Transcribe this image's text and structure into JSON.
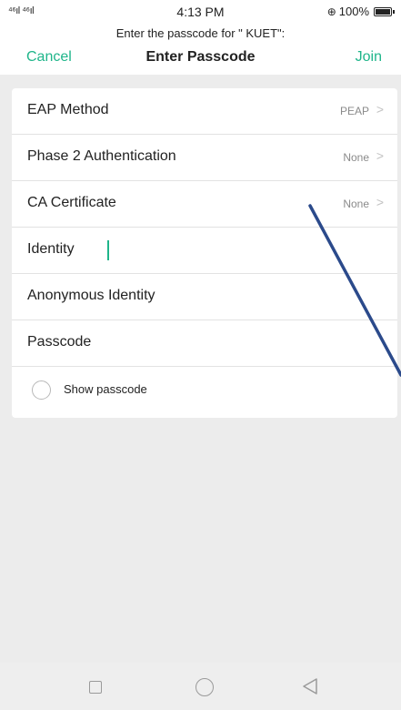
{
  "status_bar": {
    "signal": "⁴⁶ıl ⁴⁶ıl",
    "time": "4:13 PM",
    "battery": "100%"
  },
  "header": {
    "prompt": "Enter the passcode for \" KUET\":",
    "title": "Enter Passcode",
    "cancel_label": "Cancel",
    "join_label": "Join"
  },
  "form": {
    "rows": [
      {
        "label": "EAP Method",
        "value": "PEAP"
      },
      {
        "label": "Phase 2 Authentication",
        "value": "None"
      },
      {
        "label": "CA Certificate",
        "value": "None"
      },
      {
        "label": "Identity",
        "value": ""
      },
      {
        "label": "Anonymous Identity",
        "value": ""
      },
      {
        "label": "Passcode",
        "value": ""
      }
    ],
    "show_passcode_label": "Show passcode",
    "show_passcode_checked": false
  },
  "nav_bar": {
    "buttons": [
      "back",
      "home",
      "recent"
    ]
  },
  "colors": {
    "accent": "#1fb58a",
    "pen_annotation": "#2b4a8b"
  }
}
